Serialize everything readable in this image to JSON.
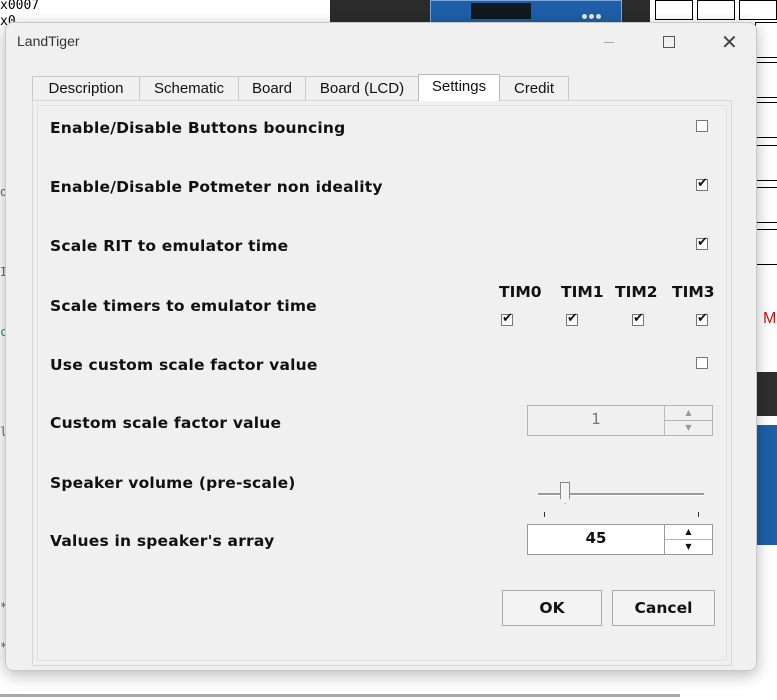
{
  "background": {
    "code_lines": [
      "x0007",
      "x0"
    ],
    "side_text": "M"
  },
  "window": {
    "title": "LandTiger",
    "controls": {
      "minimize_icon": "minimize-icon",
      "maximize_icon": "maximize-icon",
      "close_icon": "close-icon"
    }
  },
  "tabs": [
    {
      "label": "Description",
      "active": false
    },
    {
      "label": "Schematic",
      "active": false
    },
    {
      "label": "Board",
      "active": false
    },
    {
      "label": "Board (LCD)",
      "active": false
    },
    {
      "label": "Settings",
      "active": true
    },
    {
      "label": "Credit",
      "active": false
    }
  ],
  "settings": {
    "buttons_bouncing": {
      "label": "Enable/Disable Buttons bouncing",
      "checked": false
    },
    "potmeter": {
      "label": "Enable/Disable Potmeter non ideality",
      "checked": true
    },
    "scale_rit": {
      "label": "Scale RIT to emulator time",
      "checked": true
    },
    "scale_timers": {
      "label": "Scale timers to emulator time",
      "timers": [
        {
          "label": "TIM0",
          "checked": true
        },
        {
          "label": "TIM1",
          "checked": true
        },
        {
          "label": "TIM2",
          "checked": true
        },
        {
          "label": "TIM3",
          "checked": true
        }
      ]
    },
    "custom_scale_use": {
      "label": "Use custom scale factor value",
      "checked": false
    },
    "custom_scale_value": {
      "label": "Custom scale factor value",
      "value": "1",
      "enabled": false
    },
    "speaker_volume": {
      "label": "Speaker volume (pre-scale)",
      "level": 0.14
    },
    "speaker_values": {
      "label": "Values in speaker's array",
      "value": "45"
    }
  },
  "buttons": {
    "ok": "OK",
    "cancel": "Cancel"
  },
  "glyphs": {
    "check": "✔",
    "up": "▲",
    "down": "▼",
    "close": "✕"
  }
}
